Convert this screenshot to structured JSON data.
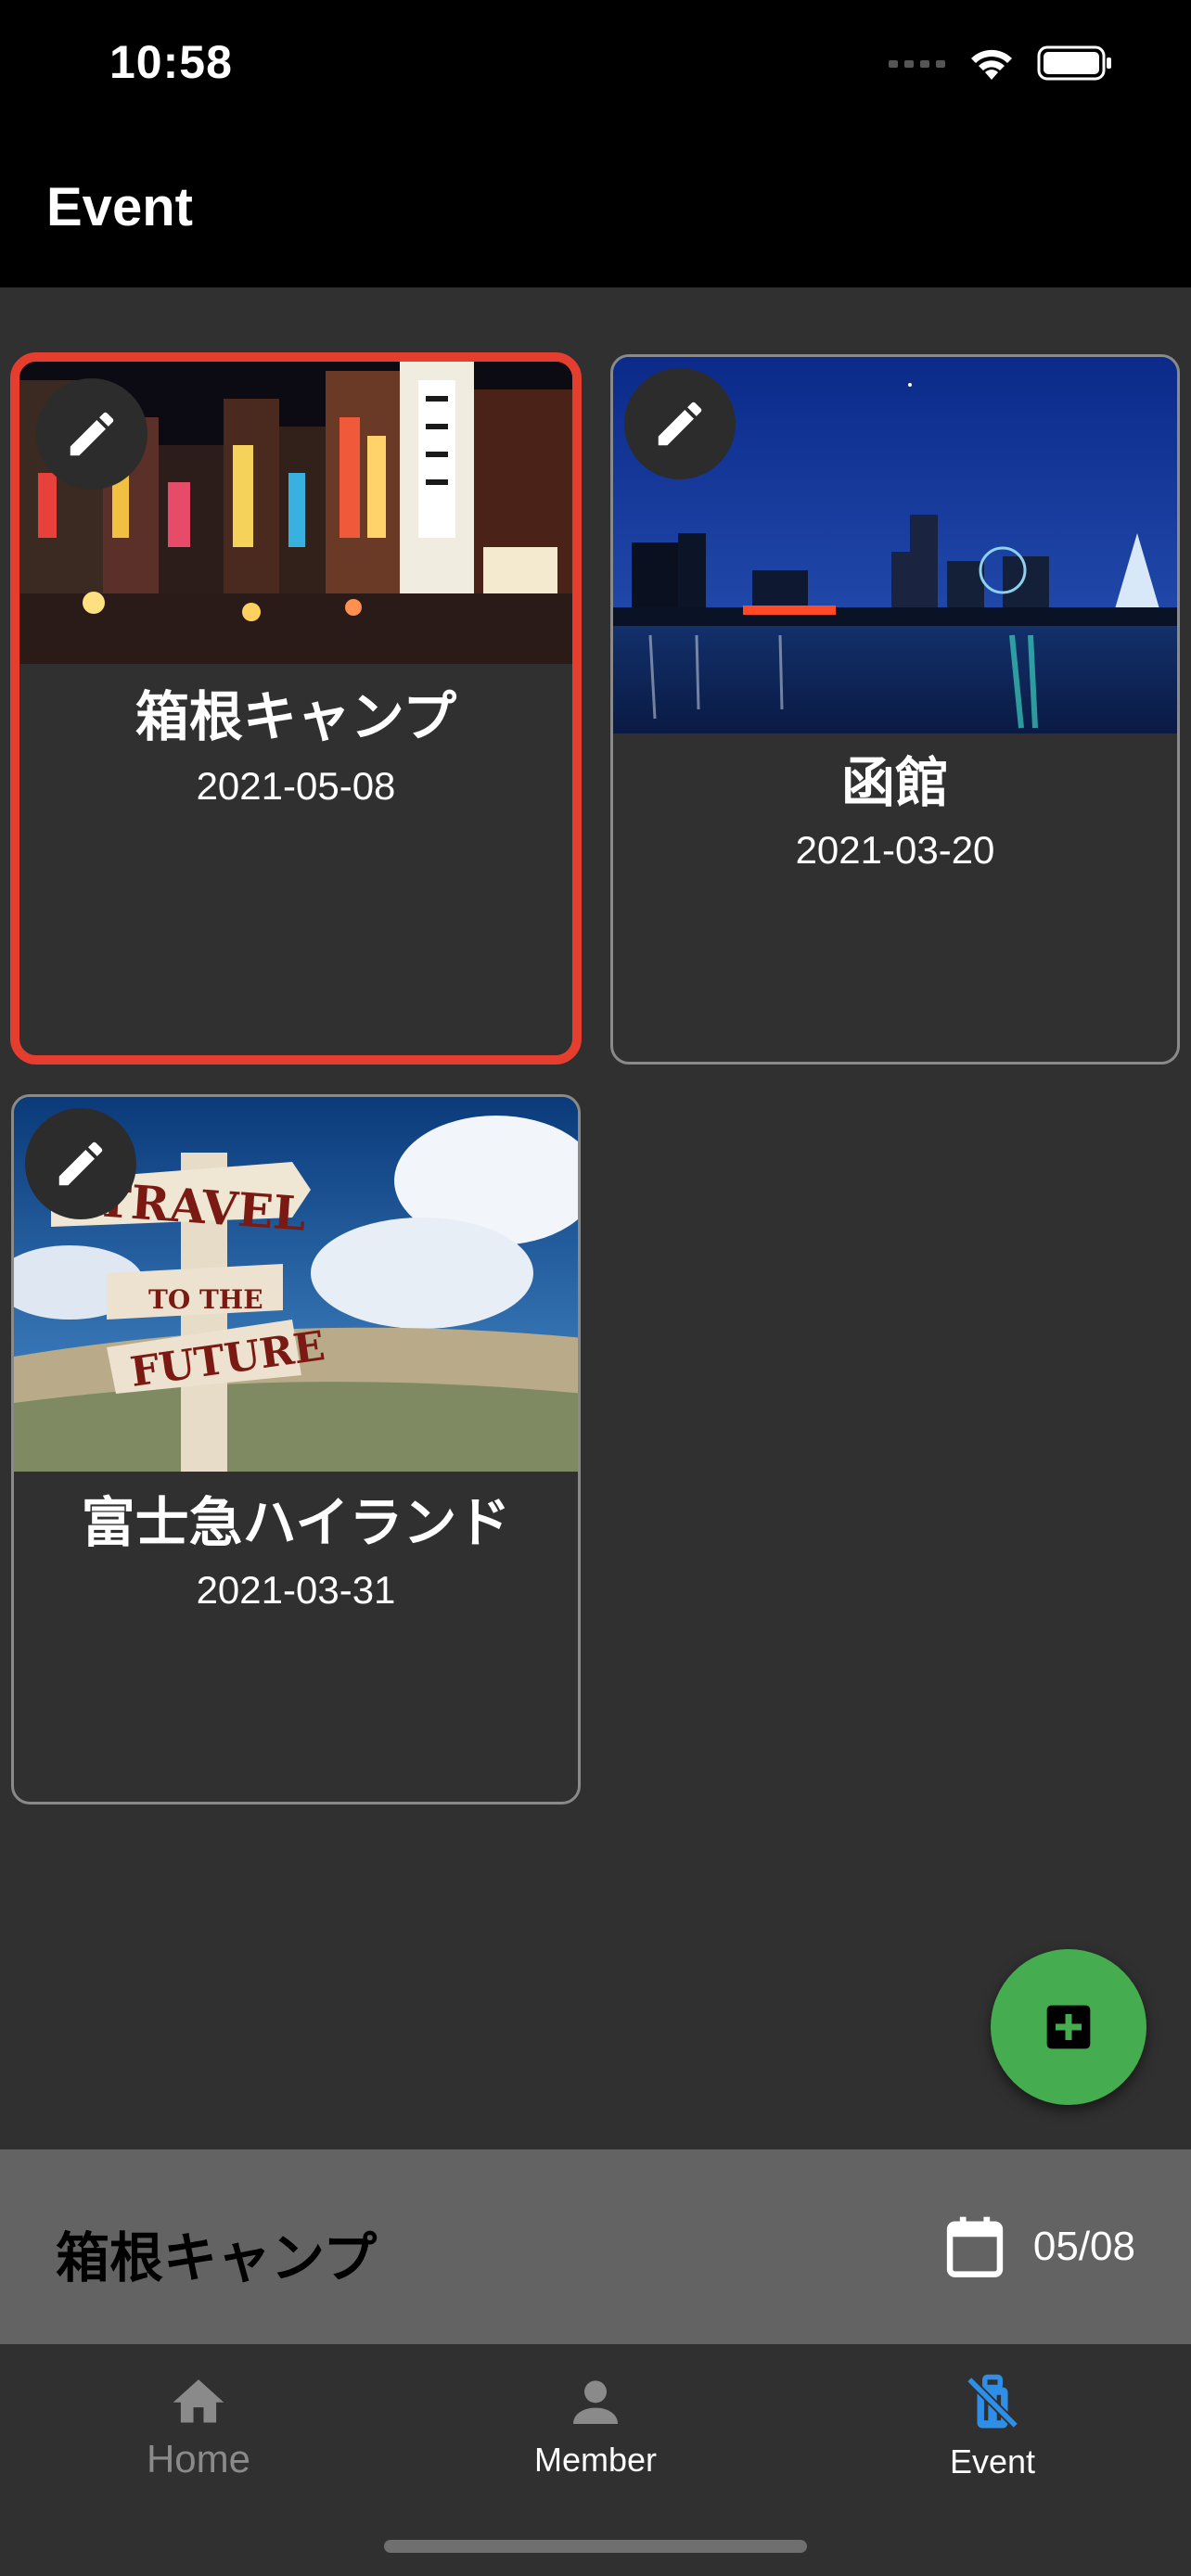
{
  "status_bar": {
    "time": "10:58"
  },
  "app_bar": {
    "title": "Event"
  },
  "events": [
    {
      "title": "箱根キャンプ",
      "date": "2021-05-08",
      "selected": true,
      "image": "night-street-neon"
    },
    {
      "title": "函館",
      "date": "2021-03-20",
      "selected": false,
      "image": "night-harbor-skyline"
    },
    {
      "title": "富士急ハイランド",
      "date": "2021-03-31",
      "selected": false,
      "image": "travel-to-the-future-signpost"
    }
  ],
  "signpost": {
    "line1": "TRAVEL",
    "line2": "TO THE",
    "line3": "FUTURE"
  },
  "current_event": {
    "name": "箱根キャンプ",
    "date": "05/08"
  },
  "bottom_nav": {
    "items": [
      {
        "label": "Home",
        "icon": "home-icon",
        "active": false
      },
      {
        "label": "Member",
        "icon": "person-icon",
        "active": false
      },
      {
        "label": "Event",
        "icon": "luggage-off-icon",
        "active": true
      }
    ]
  },
  "colors": {
    "selected_border": "#e53e2f",
    "fab": "#45ad4f",
    "active_nav": "#2f8fe6",
    "current_bar": "#636363"
  }
}
